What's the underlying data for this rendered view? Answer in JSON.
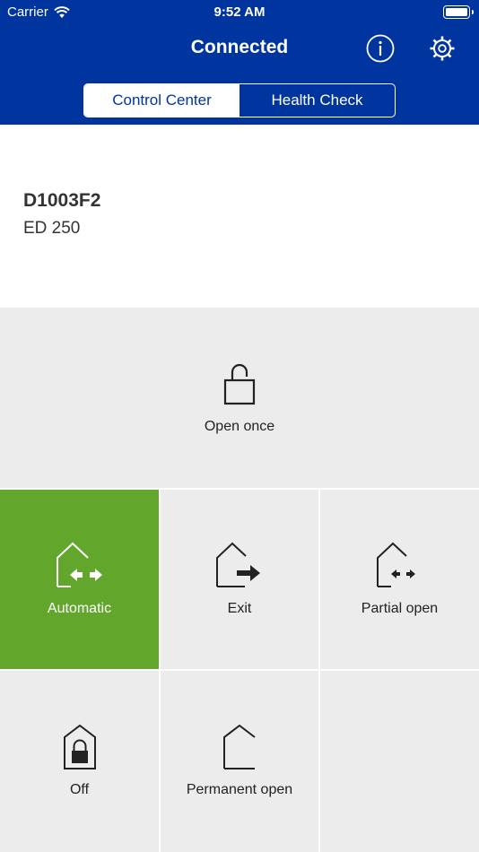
{
  "status_bar": {
    "carrier": "Carrier",
    "time": "9:52 AM"
  },
  "header": {
    "title": "Connected",
    "tabs": [
      {
        "label": "Control Center",
        "active": true
      },
      {
        "label": "Health Check",
        "active": false
      }
    ]
  },
  "device": {
    "id": "D1003F2",
    "model": "ED 250"
  },
  "modes": {
    "open_once": "Open once",
    "automatic": "Automatic",
    "exit": "Exit",
    "partial_open": "Partial open",
    "off": "Off",
    "permanent_open": "Permanent open"
  },
  "colors": {
    "header": "#0035a0",
    "active_mode": "#62a72c",
    "tile_bg": "#ececec"
  }
}
